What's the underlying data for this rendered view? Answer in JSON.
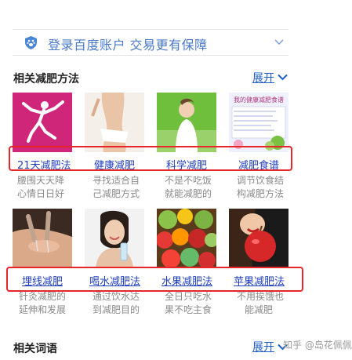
{
  "login": {
    "icon": "paw-icon",
    "text": "登录百度账户  交易更有保障"
  },
  "section1": {
    "title": "相关减肥方法",
    "expand": "展开"
  },
  "row1": [
    {
      "title": "21天减肥法",
      "desc1": "腰围天天降",
      "desc2": "心情日日好"
    },
    {
      "title": "健康减肥",
      "desc1": "寻找适合自",
      "desc2": "己减肥方式"
    },
    {
      "title": "科学减肥",
      "desc1": "不是不吃饭",
      "desc2": "就能减肥的"
    },
    {
      "title": "减肥食谱",
      "desc1": "调节饮食结",
      "desc2": "构减肥方法"
    }
  ],
  "row2": [
    {
      "title": "埋线减肥",
      "desc1": "针灸减肥的",
      "desc2": "延伸和发展"
    },
    {
      "title": "喝水减肥法",
      "desc1": "通过饮水达",
      "desc2": "到减肥目的"
    },
    {
      "title": "水果减肥法",
      "desc1": "全日只吃水",
      "desc2": "果不吃主食"
    },
    {
      "title": "苹果减肥法",
      "desc1": "不用挨饿也",
      "desc2": "能减肥"
    }
  ],
  "recipe_thumb_text": "我的健康减肥食谱",
  "section2": {
    "title": "相关词语",
    "expand": "展开"
  },
  "watermark": "知乎 @岛花佩佩",
  "colors": {
    "link": "#1f3fbe",
    "highlight_box": "#e8262a",
    "login_text": "#4a7ac9"
  }
}
